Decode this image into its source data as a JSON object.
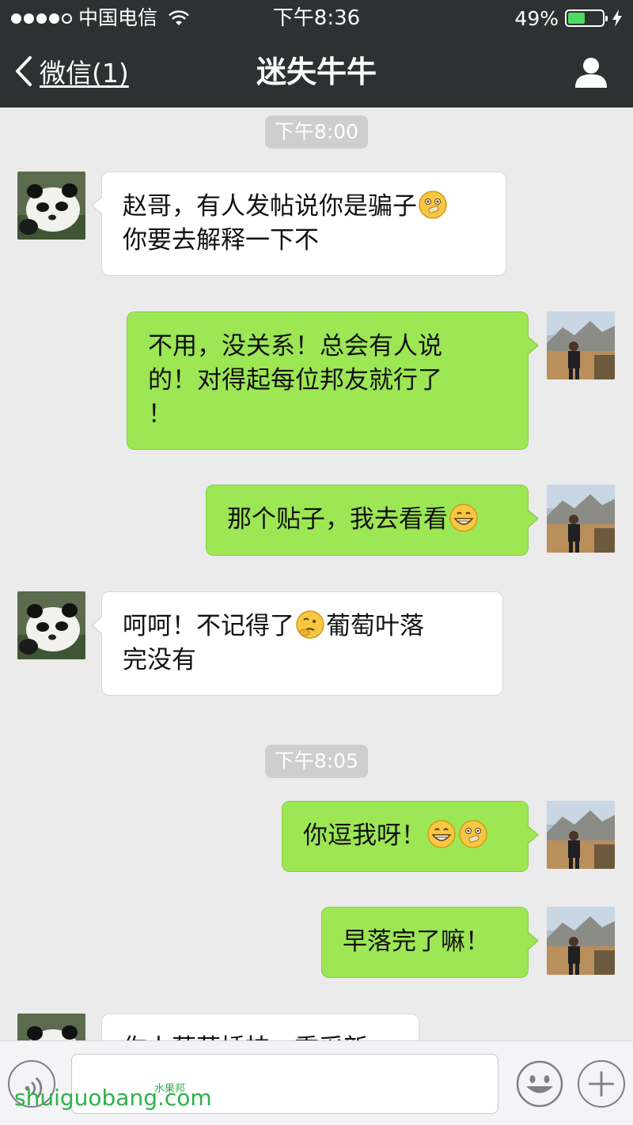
{
  "status_bar": {
    "carrier": "中国电信",
    "time": "下午8:36",
    "battery_percent": "49%",
    "battery_level": 0.49,
    "signal_bars": 4,
    "signal_max": 5
  },
  "nav": {
    "back_label": "微信(1)",
    "title": "迷失牛牛"
  },
  "timestamps": [
    "下午8:00",
    "下午8:05"
  ],
  "messages": [
    {
      "side": "in",
      "text": [
        "赵哥，有人发帖说你是骗子",
        "你要去解释一下不"
      ],
      "emoji": "shushing-face"
    },
    {
      "side": "out",
      "text": [
        "不用，没关系！总会有人说",
        "的！对得起每位邦友就行了",
        "！"
      ]
    },
    {
      "side": "out",
      "text": [
        "那个贴子，我去看看"
      ],
      "emoji": "grinning-face"
    },
    {
      "side": "in",
      "text": [
        "呵呵！不记得了",
        "葡萄叶落",
        "完没有"
      ],
      "emoji": "thinking-face"
    },
    {
      "side": "out",
      "text": [
        "你逗我呀！"
      ],
      "emoji": [
        "grinning-face",
        "shushing-face"
      ]
    },
    {
      "side": "out",
      "text": [
        "早落完了嘛！"
      ]
    },
    {
      "side": "in",
      "text": [
        "你上葡萄插枝，重采新"
      ]
    }
  ],
  "input": {
    "value": "",
    "placeholder": ""
  },
  "watermark": {
    "text": "shuiguobang.com",
    "small": "水果邦"
  },
  "colors": {
    "bar_bg": "#2e3132",
    "chat_bg": "#ebebeb",
    "outgoing_bubble": "#9de654",
    "incoming_bubble": "#ffffff",
    "battery_fill": "#4cd964",
    "watermark": "#2cb24a"
  },
  "icons": {
    "back": "chevron-left-icon",
    "profile": "person-icon",
    "voice": "voice-icon",
    "emoji": "smiley-icon",
    "plus": "plus-icon",
    "wifi": "wifi-icon",
    "charging": "bolt-icon"
  }
}
